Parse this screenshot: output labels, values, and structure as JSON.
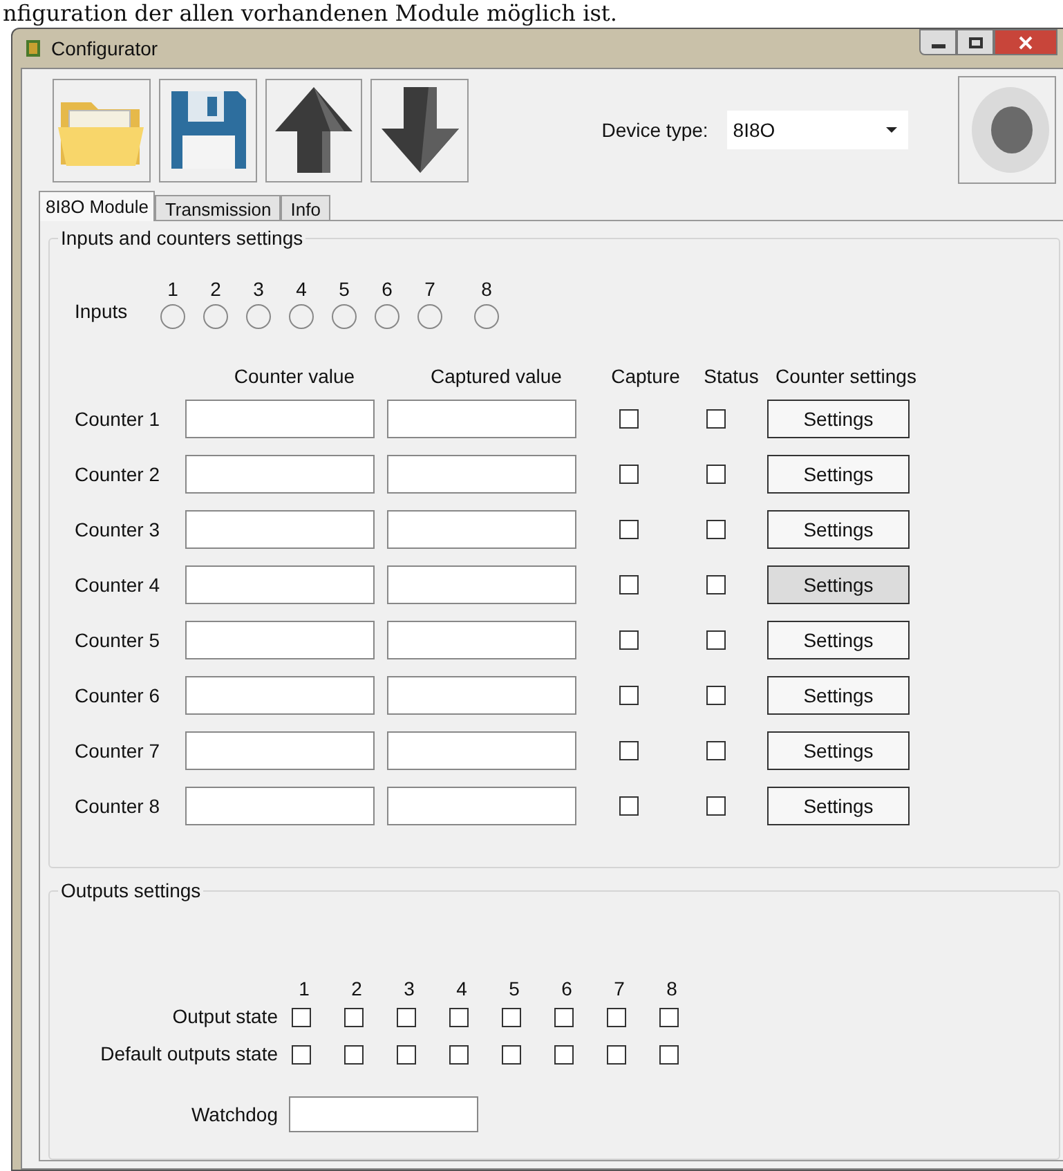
{
  "document_text": "nfiguration der allen vorhandenen Module möglich ist.",
  "window": {
    "title": "Configurator"
  },
  "toolbar": {
    "buttons": [
      {
        "kind": "open"
      },
      {
        "kind": "save"
      },
      {
        "kind": "upload"
      },
      {
        "kind": "download"
      }
    ],
    "device_type": {
      "label": "Device type:",
      "value": "8I8O"
    }
  },
  "tabs": [
    {
      "label": "8I8O Module",
      "selected": true
    },
    {
      "label": "Transmission",
      "selected": false
    },
    {
      "label": "Info",
      "selected": false
    }
  ],
  "inputs_group": {
    "title": "Inputs and counters settings",
    "inputs_label": "Inputs",
    "inputs": [
      {
        "label": "1",
        "on": false
      },
      {
        "label": "2",
        "on": false
      },
      {
        "label": "3",
        "on": false
      },
      {
        "label": "4",
        "on": false
      },
      {
        "label": "5",
        "on": false
      },
      {
        "label": "6",
        "on": false
      },
      {
        "label": "7",
        "on": false
      },
      {
        "label": "8",
        "on": false
      }
    ],
    "columns": [
      "Counter value",
      "Captured value",
      "Capture",
      "Status",
      "Counter settings"
    ],
    "counters": [
      {
        "label": "Counter 1",
        "capture": false,
        "status": false,
        "button": "Settings",
        "hovered": false
      },
      {
        "label": "Counter 2",
        "capture": false,
        "status": false,
        "button": "Settings",
        "hovered": false
      },
      {
        "label": "Counter 3",
        "capture": false,
        "status": false,
        "button": "Settings",
        "hovered": false
      },
      {
        "label": "Counter 4",
        "capture": false,
        "status": false,
        "button": "Settings",
        "hovered": true
      },
      {
        "label": "Counter 5",
        "capture": false,
        "status": false,
        "button": "Settings",
        "hovered": false
      },
      {
        "label": "Counter 6",
        "capture": false,
        "status": false,
        "button": "Settings",
        "hovered": false
      },
      {
        "label": "Counter 7",
        "capture": false,
        "status": false,
        "button": "Settings",
        "hovered": false
      },
      {
        "label": "Counter 8",
        "capture": false,
        "status": false,
        "button": "Settings",
        "hovered": false
      }
    ]
  },
  "outputs_group": {
    "title": "Outputs settings",
    "numbers": [
      "1",
      "2",
      "3",
      "4",
      "5",
      "6",
      "7",
      "8"
    ],
    "rows": [
      {
        "label": "Output state",
        "checks": [
          false,
          false,
          false,
          false,
          false,
          false,
          false,
          false
        ]
      },
      {
        "label": "Default outputs state",
        "checks": [
          false,
          false,
          false,
          false,
          false,
          false,
          false,
          false
        ]
      }
    ],
    "watchdog_label": "Watchdog"
  }
}
